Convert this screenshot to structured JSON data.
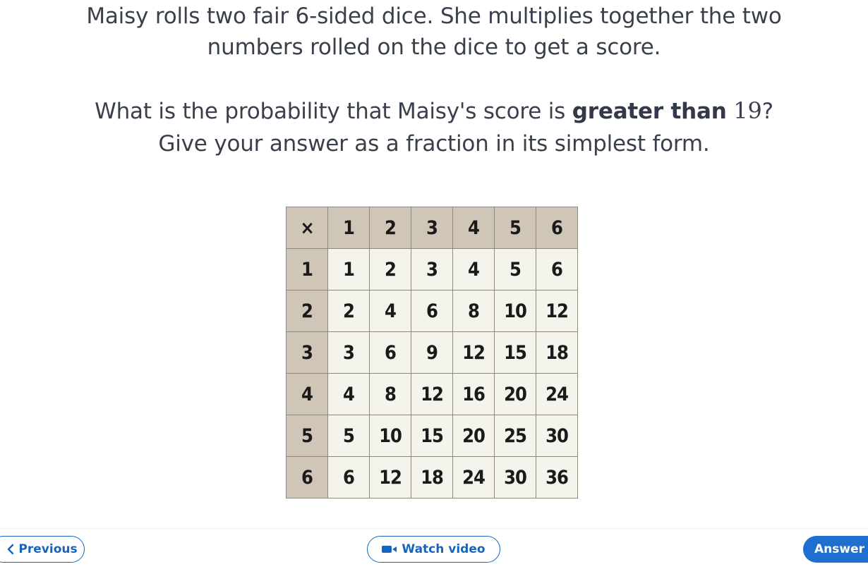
{
  "question": {
    "line1": "Maisy rolls two fair 6-sided dice. She multiplies together the two",
    "line2": "numbers rolled on the dice to get a score.",
    "line3_prefix": "What is the probability that Maisy's score is ",
    "line3_bold": "greater than",
    "line3_number": "19",
    "line3_suffix": "?",
    "line4": "Give your answer as a fraction in its simplest form."
  },
  "table": {
    "rows": [
      [
        "×",
        "1",
        "2",
        "3",
        "4",
        "5",
        "6"
      ],
      [
        "1",
        "1",
        "2",
        "3",
        "4",
        "5",
        "6"
      ],
      [
        "2",
        "2",
        "4",
        "6",
        "8",
        "10",
        "12"
      ],
      [
        "3",
        "3",
        "6",
        "9",
        "12",
        "15",
        "18"
      ],
      [
        "4",
        "4",
        "8",
        "12",
        "16",
        "20",
        "24"
      ],
      [
        "5",
        "5",
        "10",
        "15",
        "20",
        "25",
        "30"
      ],
      [
        "6",
        "6",
        "12",
        "18",
        "24",
        "30",
        "36"
      ]
    ]
  },
  "nav": {
    "previous_label": "Previous",
    "video_label": "Watch video",
    "answer_label": "Answer"
  },
  "colors": {
    "accent": "#1565c0",
    "header_cell": "#cfc6b8",
    "body_cell": "#f4f3ec"
  },
  "icons": {
    "previous": "chevron-left-icon",
    "video": "video-camera-icon"
  }
}
